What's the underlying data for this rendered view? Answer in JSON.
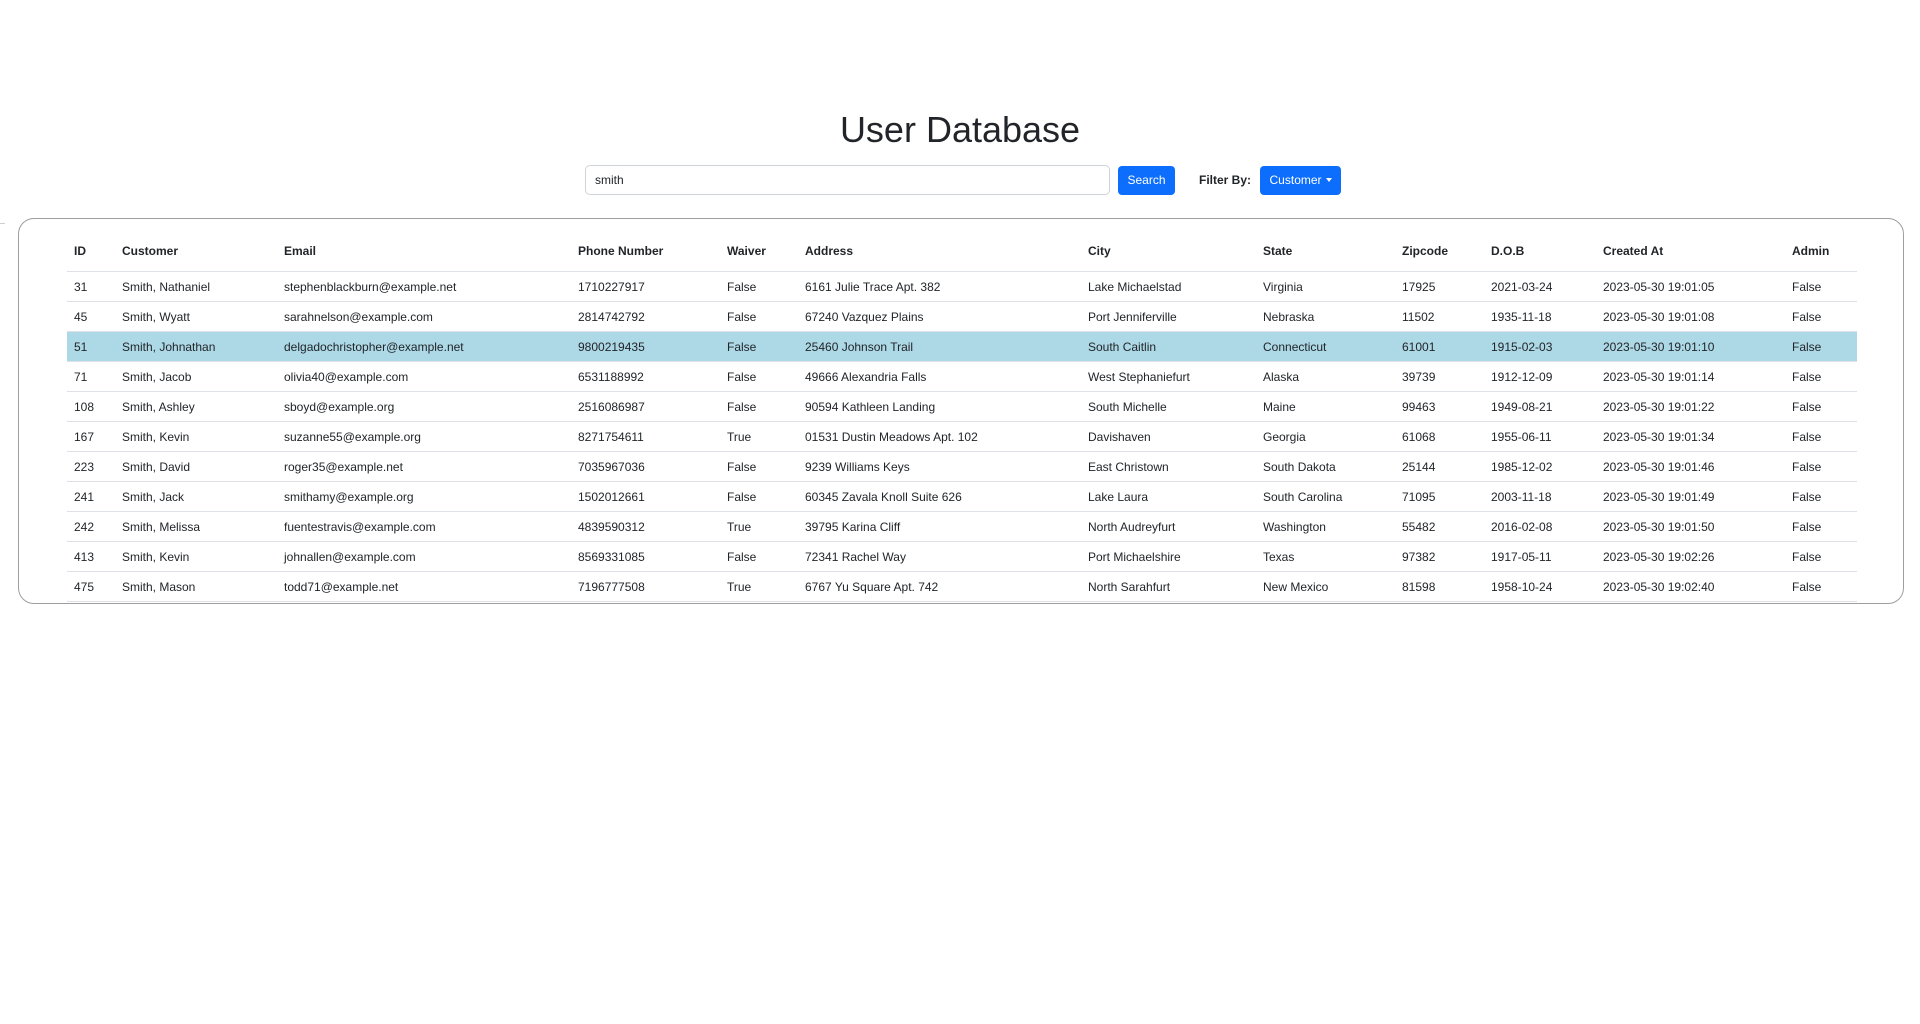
{
  "page": {
    "title": "User Database"
  },
  "search": {
    "value": "smith",
    "button_label": "Search"
  },
  "filter": {
    "label": "Filter By:",
    "selected": "Customer"
  },
  "table": {
    "columns": [
      "ID",
      "Customer",
      "Email",
      "Phone Number",
      "Waiver",
      "Address",
      "City",
      "State",
      "Zipcode",
      "D.O.B",
      "Created At",
      "Admin"
    ],
    "selected_row_index": 2,
    "highlight_color": "#add8e6",
    "rows": [
      [
        "31",
        "Smith, Nathaniel",
        "stephenblackburn@example.net",
        "1710227917",
        "False",
        "6161 Julie Trace Apt. 382",
        "Lake Michaelstad",
        "Virginia",
        "17925",
        "2021-03-24",
        "2023-05-30 19:01:05",
        "False"
      ],
      [
        "45",
        "Smith, Wyatt",
        "sarahnelson@example.com",
        "2814742792",
        "False",
        "67240 Vazquez Plains",
        "Port Jenniferville",
        "Nebraska",
        "11502",
        "1935-11-18",
        "2023-05-30 19:01:08",
        "False"
      ],
      [
        "51",
        "Smith, Johnathan",
        "delgadochristopher@example.net",
        "9800219435",
        "False",
        "25460 Johnson Trail",
        "South Caitlin",
        "Connecticut",
        "61001",
        "1915-02-03",
        "2023-05-30 19:01:10",
        "False"
      ],
      [
        "71",
        "Smith, Jacob",
        "olivia40@example.com",
        "6531188992",
        "False",
        "49666 Alexandria Falls",
        "West Stephaniefurt",
        "Alaska",
        "39739",
        "1912-12-09",
        "2023-05-30 19:01:14",
        "False"
      ],
      [
        "108",
        "Smith, Ashley",
        "sboyd@example.org",
        "2516086987",
        "False",
        "90594 Kathleen Landing",
        "South Michelle",
        "Maine",
        "99463",
        "1949-08-21",
        "2023-05-30 19:01:22",
        "False"
      ],
      [
        "167",
        "Smith, Kevin",
        "suzanne55@example.org",
        "8271754611",
        "True",
        "01531 Dustin Meadows Apt. 102",
        "Davishaven",
        "Georgia",
        "61068",
        "1955-06-11",
        "2023-05-30 19:01:34",
        "False"
      ],
      [
        "223",
        "Smith, David",
        "roger35@example.net",
        "7035967036",
        "False",
        "9239 Williams Keys",
        "East Christown",
        "South Dakota",
        "25144",
        "1985-12-02",
        "2023-05-30 19:01:46",
        "False"
      ],
      [
        "241",
        "Smith, Jack",
        "smithamy@example.org",
        "1502012661",
        "False",
        "60345 Zavala Knoll Suite 626",
        "Lake Laura",
        "South Carolina",
        "71095",
        "2003-11-18",
        "2023-05-30 19:01:49",
        "False"
      ],
      [
        "242",
        "Smith, Melissa",
        "fuentestravis@example.com",
        "4839590312",
        "True",
        "39795 Karina Cliff",
        "North Audreyfurt",
        "Washington",
        "55482",
        "2016-02-08",
        "2023-05-30 19:01:50",
        "False"
      ],
      [
        "413",
        "Smith, Kevin",
        "johnallen@example.com",
        "8569331085",
        "False",
        "72341 Rachel Way",
        "Port Michaelshire",
        "Texas",
        "97382",
        "1917-05-11",
        "2023-05-30 19:02:26",
        "False"
      ],
      [
        "475",
        "Smith, Mason",
        "todd71@example.net",
        "7196777508",
        "True",
        "6767 Yu Square Apt. 742",
        "North Sarahfurt",
        "New Mexico",
        "81598",
        "1958-10-24",
        "2023-05-30 19:02:40",
        "False"
      ]
    ]
  }
}
